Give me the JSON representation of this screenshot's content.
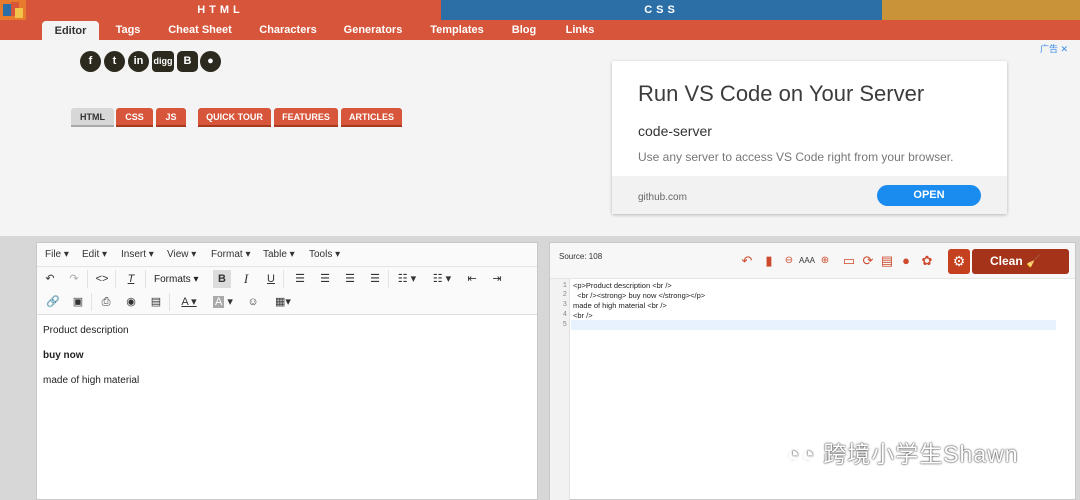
{
  "top_bar": {
    "html_label": "HTML",
    "css_label": "CSS"
  },
  "nav": {
    "items": [
      "Editor",
      "Tags",
      "Cheat Sheet",
      "Characters",
      "Generators",
      "Templates",
      "Blog",
      "Links"
    ]
  },
  "social": {
    "icons": [
      "facebook-icon",
      "twitter-icon",
      "linkedin-icon",
      "digg-icon",
      "blogger-icon",
      "reddit-icon"
    ],
    "digg_text": "digg"
  },
  "subtabs": [
    "HTML",
    "CSS",
    "JS",
    "QUICK TOUR",
    "FEATURES",
    "ARTICLES"
  ],
  "ad": {
    "label": "广告",
    "title": "Run VS Code on Your Server",
    "subtitle": "code-server",
    "description": "Use any server to access VS Code right from your browser.",
    "domain": "github.com",
    "cta": "OPEN"
  },
  "editor": {
    "menu": [
      "File",
      "Edit",
      "Insert",
      "View",
      "Format",
      "Table",
      "Tools"
    ],
    "formats_label": "Formats",
    "content": [
      "Product description",
      "buy now",
      "made of high material"
    ]
  },
  "source": {
    "counter": "Source: 108",
    "clean_label": "Clean",
    "lines": [
      {
        "n": "1",
        "text": "<p>Product description <br />"
      },
      {
        "n": "2",
        "text": "  <br /><strong> buy now </strong></p>"
      },
      {
        "n": "3",
        "text": "made of high material <br />"
      },
      {
        "n": "4",
        "text": "<br />"
      },
      {
        "n": "5",
        "text": ""
      }
    ]
  },
  "watermark": "跨境小学生Shawn",
  "colors": {
    "brand_red": "#d7553a",
    "css_blue": "#2c6fa6",
    "js_gold": "#c9933a",
    "cta_blue": "#1a8cf0",
    "clean_dark": "#a5331a"
  }
}
